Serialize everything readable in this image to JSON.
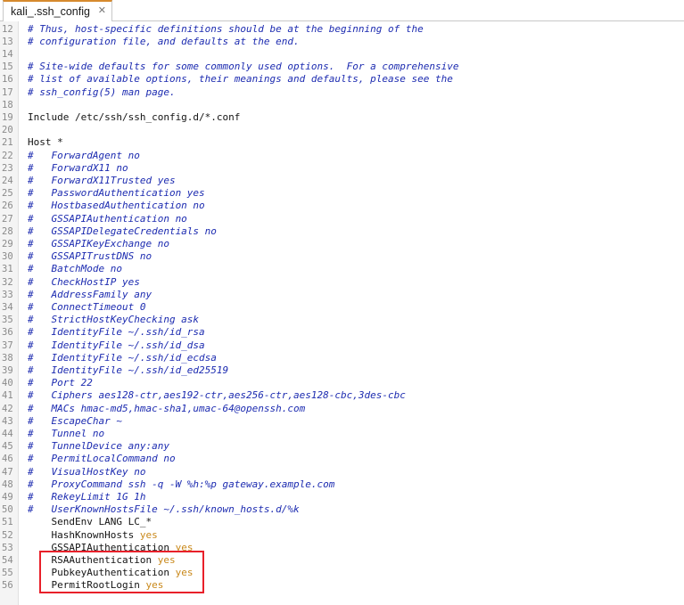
{
  "tab": {
    "title": "kali_.ssh_config",
    "close_glyph": "✕"
  },
  "lines": [
    {
      "n": "12",
      "text": "# Thus, host-specific definitions should be at the beginning of the",
      "type": "comment"
    },
    {
      "n": "13",
      "text": "# configuration file, and defaults at the end.",
      "type": "comment"
    },
    {
      "n": "14",
      "text": "",
      "type": "plain"
    },
    {
      "n": "15",
      "text": "# Site-wide defaults for some commonly used options.  For a comprehensive",
      "type": "comment"
    },
    {
      "n": "16",
      "text": "# list of available options, their meanings and defaults, please see the",
      "type": "comment"
    },
    {
      "n": "17",
      "text": "# ssh_config(5) man page.",
      "type": "comment"
    },
    {
      "n": "18",
      "text": "",
      "type": "plain"
    },
    {
      "n": "19",
      "text": "Include /etc/ssh/ssh_config.d/*.conf",
      "type": "plain"
    },
    {
      "n": "20",
      "text": "",
      "type": "plain"
    },
    {
      "n": "21",
      "text": "Host *",
      "type": "plain"
    },
    {
      "n": "22",
      "text": "#   ForwardAgent no",
      "type": "comment"
    },
    {
      "n": "23",
      "text": "#   ForwardX11 no",
      "type": "comment"
    },
    {
      "n": "24",
      "text": "#   ForwardX11Trusted yes",
      "type": "comment"
    },
    {
      "n": "25",
      "text": "#   PasswordAuthentication yes",
      "type": "comment"
    },
    {
      "n": "26",
      "text": "#   HostbasedAuthentication no",
      "type": "comment"
    },
    {
      "n": "27",
      "text": "#   GSSAPIAuthentication no",
      "type": "comment"
    },
    {
      "n": "28",
      "text": "#   GSSAPIDelegateCredentials no",
      "type": "comment"
    },
    {
      "n": "29",
      "text": "#   GSSAPIKeyExchange no",
      "type": "comment"
    },
    {
      "n": "30",
      "text": "#   GSSAPITrustDNS no",
      "type": "comment"
    },
    {
      "n": "31",
      "text": "#   BatchMode no",
      "type": "comment"
    },
    {
      "n": "32",
      "text": "#   CheckHostIP yes",
      "type": "comment"
    },
    {
      "n": "33",
      "text": "#   AddressFamily any",
      "type": "comment"
    },
    {
      "n": "34",
      "text": "#   ConnectTimeout 0",
      "type": "comment"
    },
    {
      "n": "35",
      "text": "#   StrictHostKeyChecking ask",
      "type": "comment"
    },
    {
      "n": "36",
      "text": "#   IdentityFile ~/.ssh/id_rsa",
      "type": "comment"
    },
    {
      "n": "37",
      "text": "#   IdentityFile ~/.ssh/id_dsa",
      "type": "comment"
    },
    {
      "n": "38",
      "text": "#   IdentityFile ~/.ssh/id_ecdsa",
      "type": "comment"
    },
    {
      "n": "39",
      "text": "#   IdentityFile ~/.ssh/id_ed25519",
      "type": "comment"
    },
    {
      "n": "40",
      "text": "#   Port 22",
      "type": "comment"
    },
    {
      "n": "41",
      "text": "#   Ciphers aes128-ctr,aes192-ctr,aes256-ctr,aes128-cbc,3des-cbc",
      "type": "comment"
    },
    {
      "n": "42",
      "text": "#   MACs hmac-md5,hmac-sha1,umac-64@openssh.com",
      "type": "comment"
    },
    {
      "n": "43",
      "text": "#   EscapeChar ~",
      "type": "comment"
    },
    {
      "n": "44",
      "text": "#   Tunnel no",
      "type": "comment"
    },
    {
      "n": "45",
      "text": "#   TunnelDevice any:any",
      "type": "comment"
    },
    {
      "n": "46",
      "text": "#   PermitLocalCommand no",
      "type": "comment"
    },
    {
      "n": "47",
      "text": "#   VisualHostKey no",
      "type": "comment"
    },
    {
      "n": "48",
      "text": "#   ProxyCommand ssh -q -W %h:%p gateway.example.com",
      "type": "comment"
    },
    {
      "n": "49",
      "text": "#   RekeyLimit 1G 1h",
      "type": "comment"
    },
    {
      "n": "50",
      "text": "#   UserKnownHostsFile ~/.ssh/known_hosts.d/%k",
      "type": "comment"
    },
    {
      "n": "51",
      "text": "    SendEnv LANG LC_*",
      "type": "plain"
    },
    {
      "n": "52",
      "text": "    HashKnownHosts ",
      "value": "yes",
      "type": "kv"
    },
    {
      "n": "53",
      "text": "    GSSAPIAuthentication ",
      "value": "yes",
      "type": "kv"
    },
    {
      "n": "54",
      "text": "    RSAAuthentication ",
      "value": "yes",
      "type": "kv"
    },
    {
      "n": "55",
      "text": "    PubkeyAuthentication ",
      "value": "yes",
      "type": "kv"
    },
    {
      "n": "56",
      "text": "    PermitRootLogin ",
      "value": "yes",
      "type": "kv"
    }
  ],
  "colors": {
    "comment": "#1c2bb0",
    "value": "#c9881a",
    "highlight": "#e8202a",
    "tab_accent": "#d68a2e"
  }
}
